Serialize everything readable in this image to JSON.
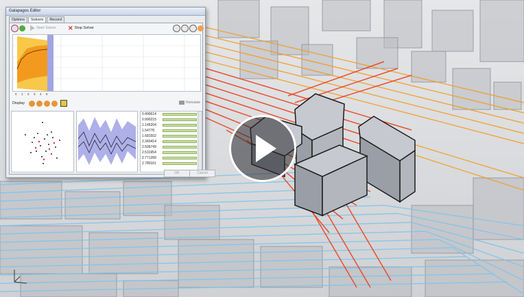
{
  "window": {
    "title": "Galapagos Editor",
    "tabs": [
      {
        "label": "Options",
        "active": false
      },
      {
        "label": "Solvers",
        "active": true
      },
      {
        "label": "Record",
        "active": false
      }
    ]
  },
  "toolbar": {
    "start_label": "Start Solver",
    "stop_label": "Stop Solver"
  },
  "fitness_axis": [
    "0",
    "1",
    "2",
    "3",
    "4",
    "5"
  ],
  "display": {
    "label": "Display",
    "reinstate_label": "Reinstate"
  },
  "genome_values": [
    "0.490614",
    "0.990215",
    "1.145204",
    "1.54778",
    "1.681502",
    "2.343414",
    "2.506749",
    "2.531954",
    "2.771289",
    "2.780161"
  ],
  "buttons": {
    "ok": "OK",
    "cancel": "Cancel"
  },
  "colors": {
    "heat": "#e8401c",
    "orange": "#f59a1c",
    "cool": "#7ec3ec",
    "building": "#a8acb3",
    "fitness_fill": "#f5b120",
    "parallel": "#6b6fd0"
  },
  "icons": [
    "play-icon",
    "start-solver-icon",
    "stop-solver-icon",
    "reinstate-icon",
    "axis-gizmo-icon"
  ]
}
